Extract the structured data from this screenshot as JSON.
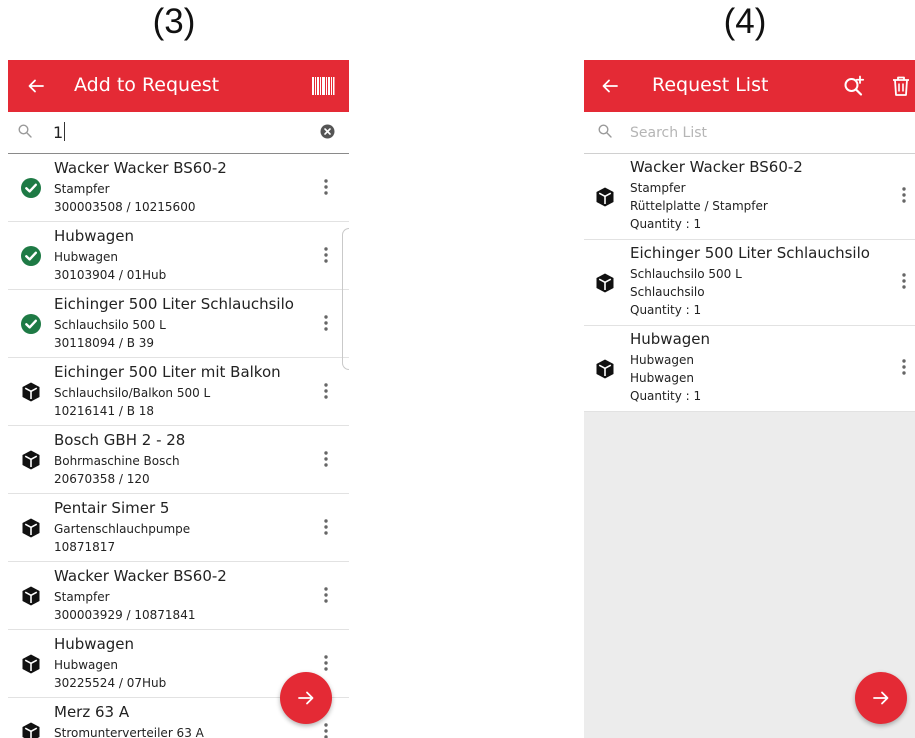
{
  "figure_labels": {
    "left": "(3)",
    "right": "(4)"
  },
  "add_to_request": {
    "title": "Add to Request",
    "search_value": "1",
    "items": [
      {
        "title": "Wacker Wacker BS60-2",
        "subtitle": "Stampfer",
        "id": "300003508 / 10215600",
        "status": "check-circle-icon"
      },
      {
        "title": "Hubwagen",
        "subtitle": "Hubwagen",
        "id": "30103904 / 01Hub",
        "status": "check-circle-icon"
      },
      {
        "title": "Eichinger 500 Liter Schlauchsilo",
        "subtitle": "Schlauchsilo 500 L",
        "id": "30118094 / B 39",
        "status": "check-circle-icon"
      },
      {
        "title": "Eichinger 500 Liter mit Balkon",
        "subtitle": "Schlauchsilo/Balkon 500 L",
        "id": "10216141 / B 18",
        "status": "cube-icon"
      },
      {
        "title": "Bosch GBH 2 - 28",
        "subtitle": "Bohrmaschine Bosch",
        "id": "20670358 / 120",
        "status": "cube-icon"
      },
      {
        "title": "Pentair Simer 5",
        "subtitle": "Gartenschlauchpumpe",
        "id": "10871817",
        "status": "cube-icon"
      },
      {
        "title": "Wacker Wacker BS60-2",
        "subtitle": "Stampfer",
        "id": "300003929 / 10871841",
        "status": "cube-icon"
      },
      {
        "title": "Hubwagen",
        "subtitle": "Hubwagen",
        "id": "30225524 / 07Hub",
        "status": "cube-icon"
      },
      {
        "title": "Merz 63 A",
        "subtitle": "Stromunterverteiler 63 A",
        "id": "",
        "status": "cube-icon"
      }
    ]
  },
  "request_list": {
    "title": "Request List",
    "search_placeholder": "Search List",
    "items": [
      {
        "title": "Wacker Wacker BS60-2",
        "line1": "Stampfer",
        "line2": "Rüttelplatte / Stampfer",
        "line3": "Quantity : 1"
      },
      {
        "title": "Eichinger 500 Liter Schlauchsilo",
        "line1": "Schlauchsilo 500 L",
        "line2": "Schlauchsilo",
        "line3": "Quantity : 1"
      },
      {
        "title": "Hubwagen",
        "line1": "Hubwagen",
        "line2": "Hubwagen",
        "line3": "Quantity : 1"
      }
    ]
  },
  "colors": {
    "brand_red": "#e42a35",
    "check_green": "#1e7a45",
    "empty_area": "#ececec"
  },
  "icons": {
    "back": "arrow-left-icon",
    "barcode": "barcode-icon",
    "search": "search-icon",
    "clear": "clear-circle-icon",
    "add_search": "search-plus-icon",
    "delete": "trash-icon",
    "row_menu": "more-vert-icon",
    "fab": "arrow-right-icon"
  }
}
